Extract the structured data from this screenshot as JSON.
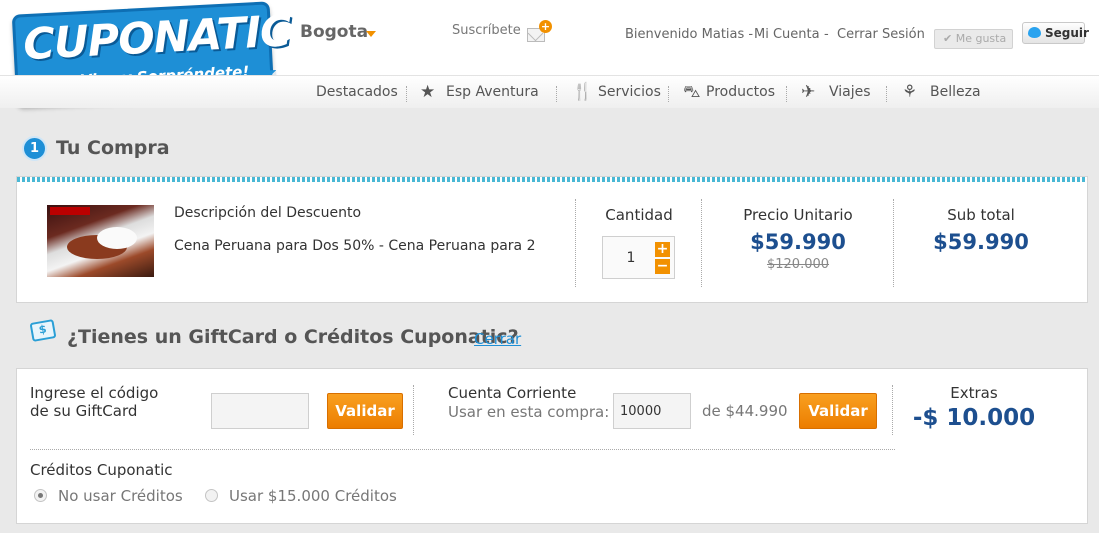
{
  "brand": {
    "name": "CUPONATIC",
    "tagline": "¡Vive y Sorpréndete!"
  },
  "header": {
    "city": "Bogota",
    "subscribe": "Suscríbete",
    "welcome": "Bienvenido Matias -",
    "account": "Mi Cuenta",
    "separator": "-",
    "logout": "Cerrar Sesión",
    "like": "Me gusta",
    "follow": "Seguir"
  },
  "nav": {
    "items": [
      {
        "label": "Destacados",
        "icon": ""
      },
      {
        "label": "Esp Aventura",
        "icon": "star-icon"
      },
      {
        "label": "Servicios",
        "icon": "dining-icon"
      },
      {
        "label": "Productos",
        "icon": "bag-icon"
      },
      {
        "label": "Viajes",
        "icon": "plane-icon"
      },
      {
        "label": "Belleza",
        "icon": "lotus-icon"
      }
    ]
  },
  "purchase": {
    "step": "1",
    "title": "Tu Compra",
    "desc_header": "Descripción del Descuento",
    "desc_text": "Cena Peruana para Dos 50% - Cena Peruana para 2",
    "qty_header": "Cantidad",
    "qty_value": "1",
    "qty_plus": "+",
    "qty_minus": "−",
    "unit_header": "Precio Unitario",
    "unit_price": "$59.990",
    "unit_old": "$120.000",
    "subtotal_header": "Sub total",
    "subtotal": "$59.990"
  },
  "gift": {
    "icon_text": "$",
    "title": "¿Tienes un GiftCard o Créditos Cuponatic?",
    "close": "Cerrar",
    "code_label_1": "Ingrese el código",
    "code_label_2": "de su GiftCard",
    "code_value": "",
    "validate": "Validar",
    "account_label": "Cuenta Corriente",
    "use_label": "Usar en esta compra:",
    "use_value": "10000",
    "of_amount": "de $44.990",
    "extras_label": "Extras",
    "extras_value": "-$ 10.000",
    "credits_title": "Créditos Cuponatic",
    "no_credits": "No usar Créditos",
    "use_credits": "Usar $15.000 Créditos"
  },
  "colors": {
    "brand_blue": "#1e8fd6",
    "price_blue": "#1d4f8f",
    "accent_orange": "#f29100"
  }
}
